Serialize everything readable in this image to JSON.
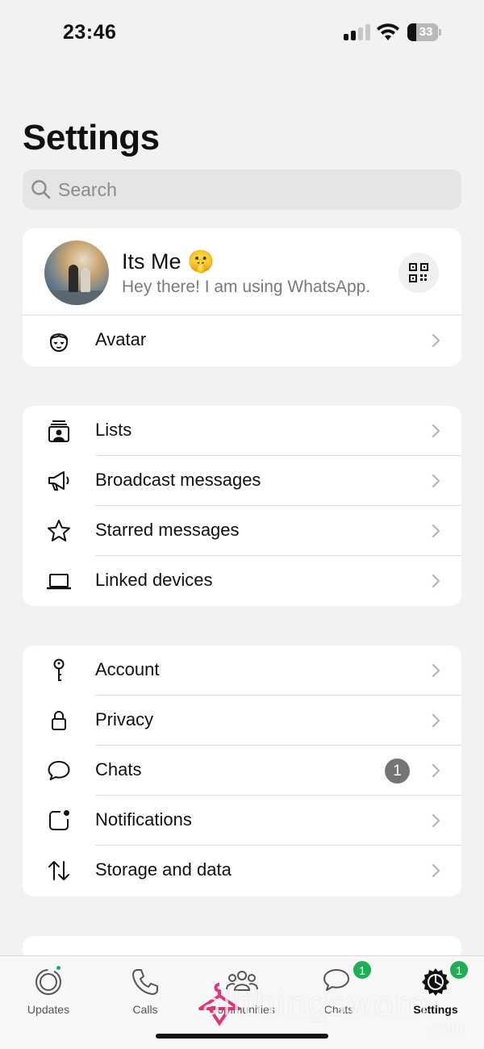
{
  "status_bar": {
    "time": "23:46",
    "battery": "33"
  },
  "header": {
    "title": "Settings"
  },
  "search": {
    "placeholder": "Search"
  },
  "profile": {
    "name": "Its Me 🤫",
    "status": "Hey there! I am using WhatsApp."
  },
  "avatar_row": {
    "label": "Avatar"
  },
  "group1": [
    {
      "label": "Lists",
      "icon": "lists-icon"
    },
    {
      "label": "Broadcast messages",
      "icon": "megaphone-icon"
    },
    {
      "label": "Starred messages",
      "icon": "star-icon"
    },
    {
      "label": "Linked devices",
      "icon": "laptop-icon"
    }
  ],
  "group2": [
    {
      "label": "Account",
      "icon": "key-icon"
    },
    {
      "label": "Privacy",
      "icon": "lock-icon"
    },
    {
      "label": "Chats",
      "icon": "chat-bubble-icon",
      "badge": "1"
    },
    {
      "label": "Notifications",
      "icon": "notification-icon"
    },
    {
      "label": "Storage and data",
      "icon": "up-down-arrows-icon"
    }
  ],
  "tabs": [
    {
      "label": "Updates",
      "icon": "updates-icon"
    },
    {
      "label": "Calls",
      "icon": "phone-icon"
    },
    {
      "label": "Communities",
      "icon": "communities-icon"
    },
    {
      "label": "Chats",
      "icon": "chats-icon",
      "badge": "1"
    },
    {
      "label": "Settings",
      "icon": "settings-gear-icon",
      "badge": "1"
    }
  ],
  "watermark": {
    "text": "allthingsworn",
    "sub": ".com"
  },
  "colors": {
    "accent_green": "#1fae55",
    "background": "#f2f2f2",
    "badge_gray": "#757575"
  }
}
